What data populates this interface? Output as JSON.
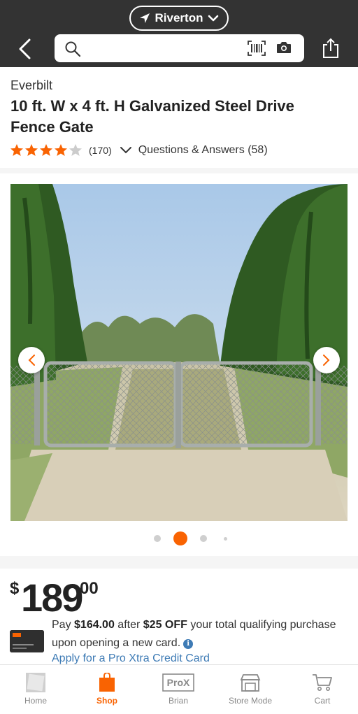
{
  "header": {
    "store_name": "Riverton",
    "search_placeholder": ""
  },
  "product": {
    "brand": "Everbilt",
    "title": "10 ft. W x 4 ft. H Galvanized Steel Drive Fence Gate",
    "rating": 4,
    "rating_max": 5,
    "review_count": "(170)",
    "qa_label": "Questions & Answers (58)",
    "image_count": 4,
    "active_image_index": 1
  },
  "price": {
    "currency": "$",
    "dollars": "189",
    "cents": "00"
  },
  "promo": {
    "pay_prefix": "Pay ",
    "pay_amount": "$164.00",
    "after_text": " after ",
    "discount": "$25 OFF",
    "tail": " your total qualifying purchase upon opening a new card.",
    "apply_link": "Apply for a Pro Xtra Credit Card"
  },
  "bottom_nav": {
    "items": [
      {
        "label": "Home",
        "icon": "home-depot-logo-icon",
        "active": false
      },
      {
        "label": "Shop",
        "icon": "shop-bag-icon",
        "active": true
      },
      {
        "label": "Brian",
        "icon": "pro-x-icon",
        "active": false
      },
      {
        "label": "Store Mode",
        "icon": "store-icon",
        "active": false
      },
      {
        "label": "Cart",
        "icon": "cart-icon",
        "active": false
      }
    ]
  },
  "colors": {
    "brand_orange": "#f96302",
    "header_bg": "#333333",
    "link_blue": "#3e7bb5",
    "star_orange": "#f96302"
  }
}
